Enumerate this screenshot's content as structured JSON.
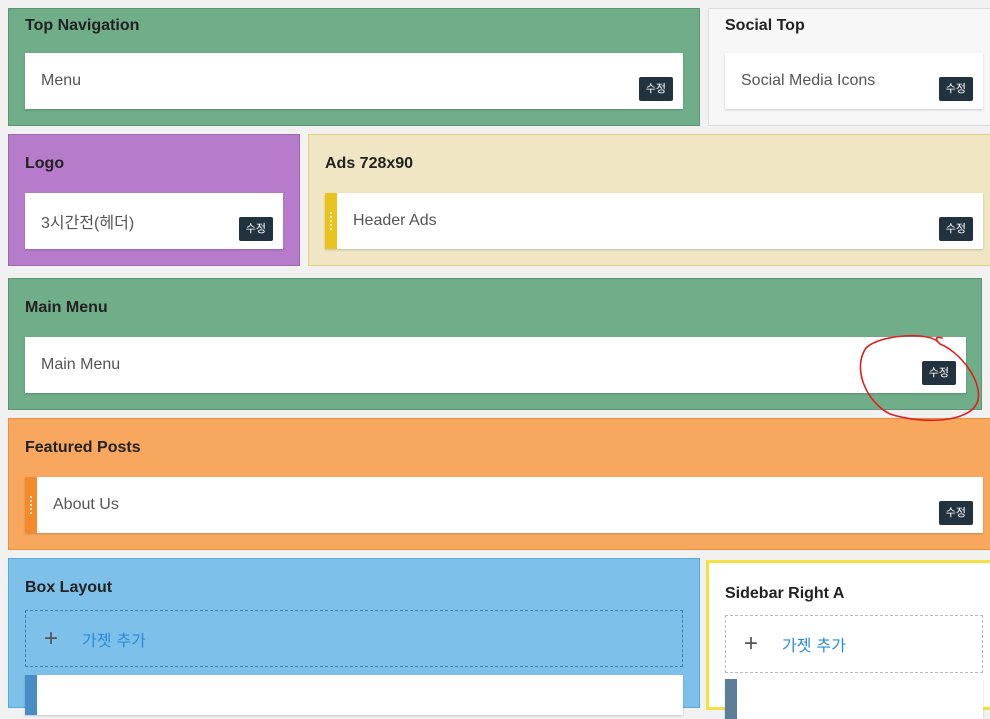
{
  "colors": {
    "green": "#6fae88",
    "purple": "#b67ccb",
    "cream": "#f0e6c3",
    "orange": "#f8a75e",
    "blue": "#7dc0ea",
    "yellow": "#f4e041",
    "dark_button": "#23323f",
    "link_blue": "#2a8bd8",
    "annotation_red": "#e02020"
  },
  "edit_label": "수정",
  "add_widget_label": "가젯 추가",
  "add_icon": "plus-icon",
  "drag_icon": "drag-handle-icon",
  "sections": {
    "top_navigation": {
      "title": "Top Navigation",
      "widget": "Menu"
    },
    "social_top": {
      "title": "Social Top",
      "widget": "Social Media Icons"
    },
    "logo": {
      "title": "Logo",
      "widget": "3시간전(헤더)"
    },
    "ads": {
      "title": "Ads 728x90",
      "widget": "Header Ads"
    },
    "main_menu": {
      "title": "Main Menu",
      "widget": "Main Menu"
    },
    "featured_posts": {
      "title": "Featured Posts",
      "widget": "About Us"
    },
    "box_layout": {
      "title": "Box Layout"
    },
    "sidebar_right_a": {
      "title": "Sidebar Right A"
    }
  }
}
